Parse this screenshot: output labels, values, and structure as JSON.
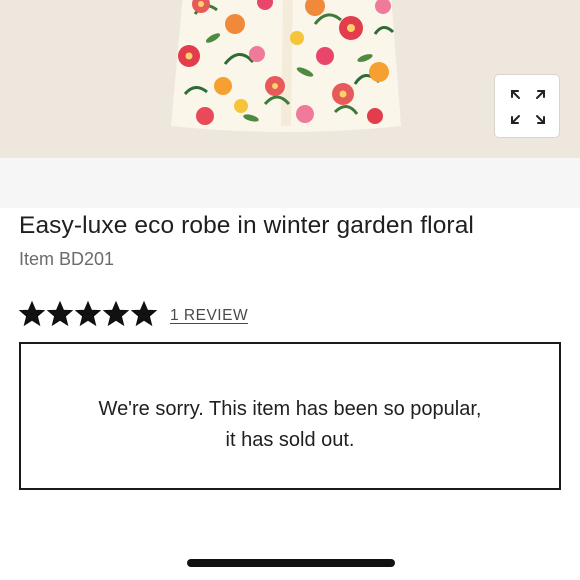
{
  "product": {
    "title": "Easy-luxe eco robe in winter garden floral",
    "item_number": "Item BD201"
  },
  "rating": {
    "stars": 5,
    "max_stars": 5,
    "review_link": "1 REVIEW"
  },
  "availability": {
    "line1": "We're sorry. This item has been so popular,",
    "line2": "it has sold out."
  },
  "icons": {
    "expand": "expand-arrows-icon",
    "star": "star-icon"
  },
  "colors": {
    "hero_background": "#ede7de",
    "thumb_strip_background": "#f6f6f6",
    "text_primary": "#1f1f1f",
    "text_secondary": "#6b6b6b",
    "star_fill": "#111111"
  }
}
